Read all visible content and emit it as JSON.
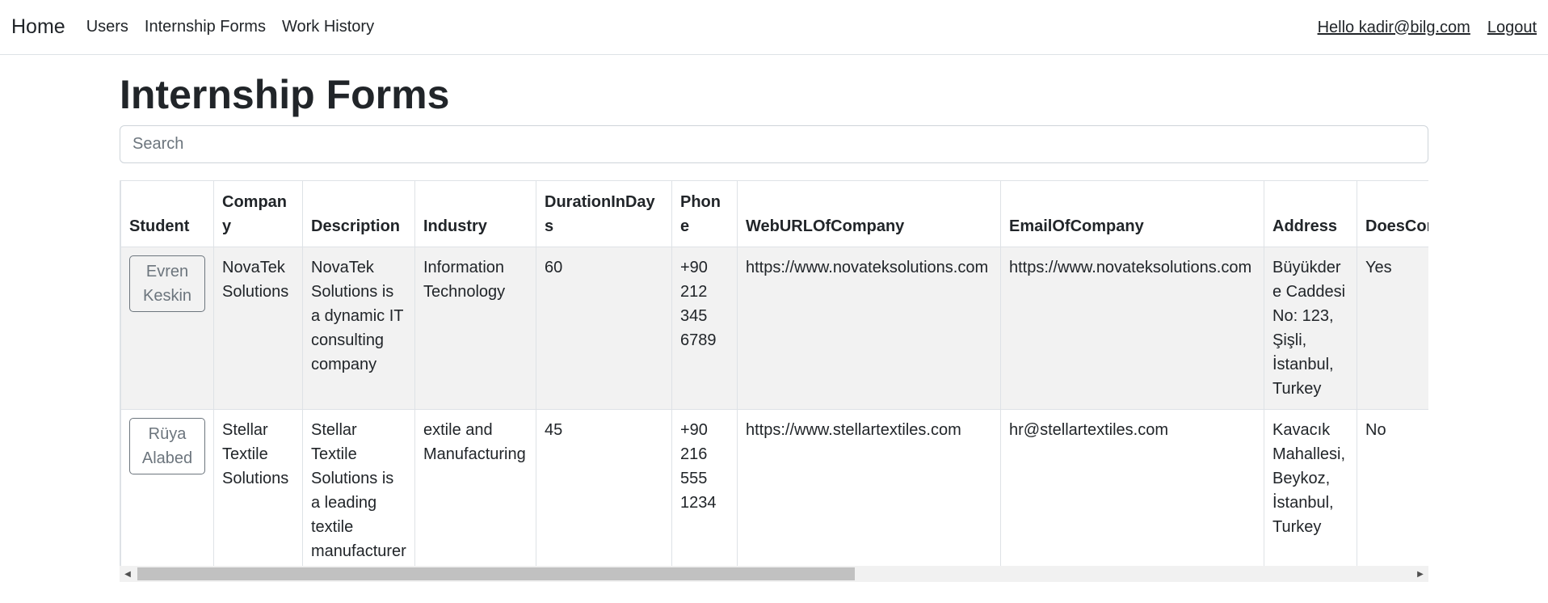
{
  "navbar": {
    "brand": "Home",
    "links": [
      "Users",
      "Internship Forms",
      "Work History"
    ],
    "hello": "Hello kadir@bilg.com",
    "logout": "Logout"
  },
  "page": {
    "title": "Internship Forms",
    "search_placeholder": "Search"
  },
  "table": {
    "headers": [
      "Student",
      "Company",
      "Description",
      "Industry",
      "DurationInDays",
      "Phone",
      "WebURLOfCompany",
      "EmailOfCompany",
      "Address",
      "DoesCom"
    ],
    "rows": [
      {
        "student": "Evren Keskin",
        "company": "NovaTek Solutions",
        "description": "NovaTek Solutions is a dynamic IT consulting company",
        "industry": "Information Technology",
        "duration": "60",
        "phone": "+90 212 345 6789",
        "web": "https://www.novateksolutions.com",
        "email": "https://www.novateksolutions.com",
        "address": "Büyükdere Caddesi No: 123, Şişli, İstanbul, Turkey",
        "does": "Yes"
      },
      {
        "student": "Rüya Alabed",
        "company": "Stellar Textile Solutions",
        "description": "Stellar Textile Solutions is a leading textile manufacturer",
        "industry": "extile and Manufacturing",
        "duration": "45",
        "phone": "+90 216 555 1234",
        "web": "https://www.stellartextiles.com",
        "email": "hr@stellartextiles.com",
        "address": "Kavacık Mahallesi, Beykoz, İstanbul, Turkey",
        "does": "No"
      }
    ]
  },
  "scrollbar": {
    "left_icon": "scroll-left-arrow",
    "right_icon": "scroll-right-arrow"
  }
}
